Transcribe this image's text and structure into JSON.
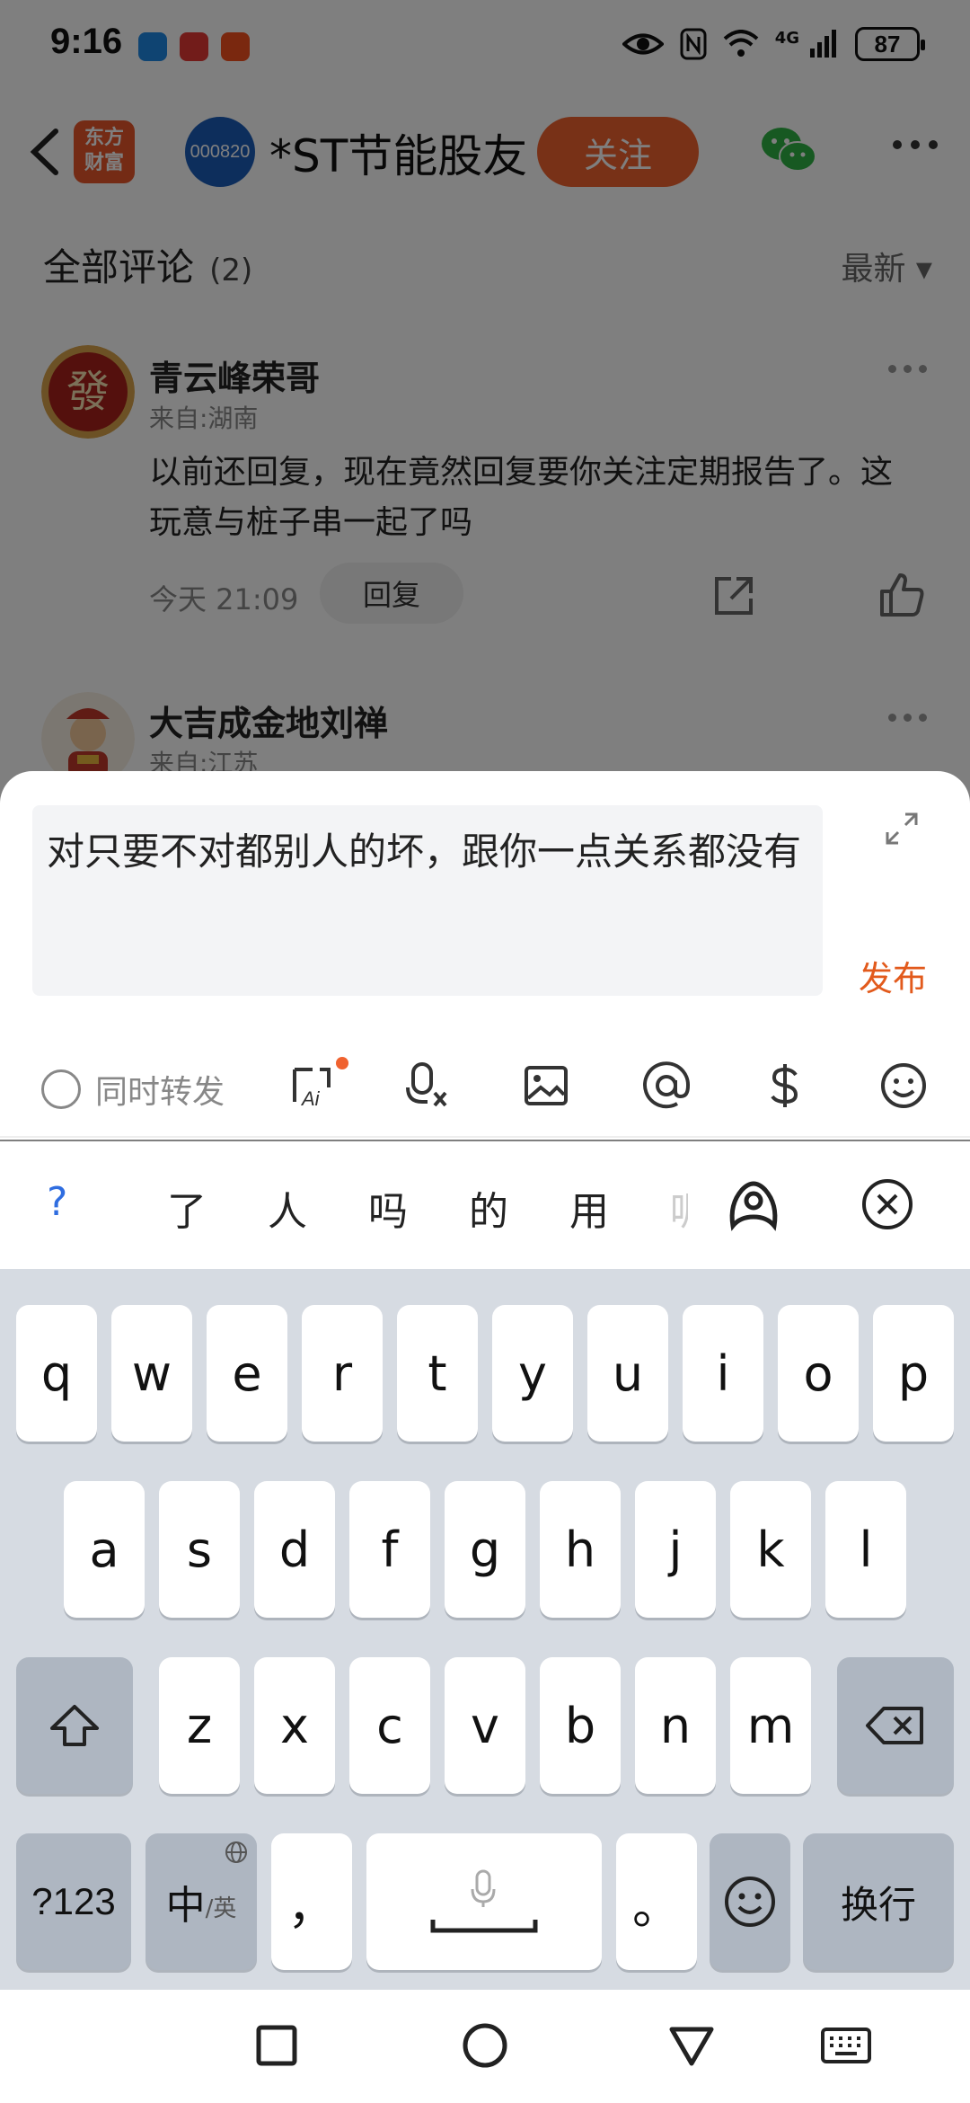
{
  "status": {
    "time": "9:16",
    "network": "4G",
    "battery": "87"
  },
  "header": {
    "app_logo": "东方\n财富",
    "stock_code": "000820",
    "forum_title": "*ST节能股友",
    "follow_label": "关注"
  },
  "comments_header": {
    "title": "全部评论",
    "count": "(2)",
    "sort_label": "最新 ▾"
  },
  "comments": [
    {
      "name": "青云峰荣哥",
      "from": "来自:湖南",
      "text": "以前还回复，现在竟然回复要你关注定期报告了。这玩意与桩子串一起了吗",
      "time": "今天 21:09",
      "reply_label": "回复"
    },
    {
      "name": "大吉成金地刘禅",
      "from": "来自:江苏"
    }
  ],
  "composer": {
    "text": "对只要不对都别人的坏，跟你一点关系都没有",
    "publish_label": "发布",
    "repost_label": "同时转发"
  },
  "candidates": [
    "?",
    "了",
    "人",
    "吗",
    "的",
    "用",
    "呢"
  ],
  "keyboard": {
    "row1": [
      "q",
      "w",
      "e",
      "r",
      "t",
      "y",
      "u",
      "i",
      "o",
      "p"
    ],
    "row2": [
      "a",
      "s",
      "d",
      "f",
      "g",
      "h",
      "j",
      "k",
      "l"
    ],
    "row3": [
      "z",
      "x",
      "c",
      "v",
      "b",
      "n",
      "m"
    ],
    "num_label": "?123",
    "lang_label": "中",
    "lang_sub": "/英",
    "comma": "，",
    "period": "。",
    "enter_label": "换行"
  },
  "icons": {
    "back": "chevron-left-icon",
    "wechat": "wechat-icon",
    "more": "more-dots-icon",
    "share": "share-icon",
    "like": "thumbs-up-icon",
    "expand": "expand-icon",
    "ai": "ai-ask-icon",
    "voice": "voice-to-text-icon",
    "image": "image-icon",
    "at": "at-icon",
    "dollar": "dollar-icon",
    "emoji": "emoji-icon"
  },
  "colors": {
    "accent": "#f0622f",
    "publish": "#e25a1c",
    "candidate_q": "#2f6de0"
  }
}
